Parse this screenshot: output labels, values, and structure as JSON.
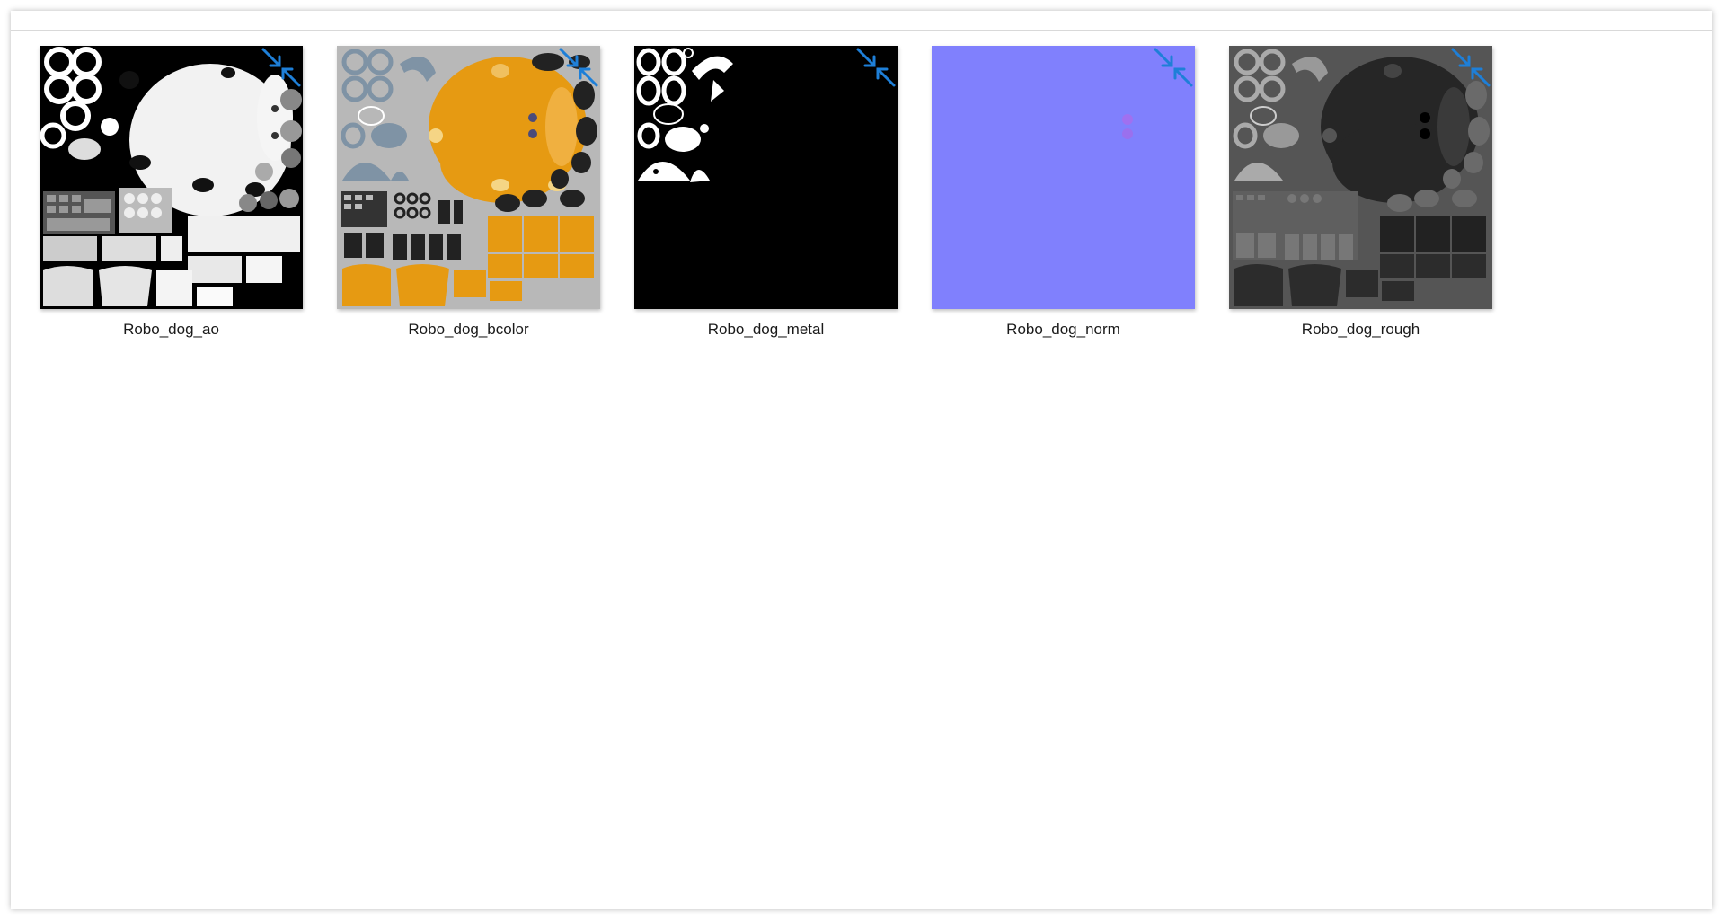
{
  "window": {
    "view": "large-icons"
  },
  "files": [
    {
      "name": "Robo_dog_ao",
      "preview": "ao",
      "overlay_icon": "compress-arrows-icon"
    },
    {
      "name": "Robo_dog_bcolor",
      "preview": "bcolor",
      "overlay_icon": "compress-arrows-icon"
    },
    {
      "name": "Robo_dog_metal",
      "preview": "metal",
      "overlay_icon": "compress-arrows-icon"
    },
    {
      "name": "Robo_dog_norm",
      "preview": "norm",
      "overlay_icon": "compress-arrows-icon"
    },
    {
      "name": "Robo_dog_rough",
      "preview": "rough",
      "overlay_icon": "compress-arrows-icon"
    }
  ],
  "colors": {
    "overlay_blue": "#1e7fd8",
    "bcolor_orange": "#e69a12",
    "bcolor_gray": "#b8b8b8",
    "bcolor_slate": "#7f93a5",
    "norm_purple": "#8080fd",
    "rough_gray": "#555555",
    "metal_black": "#000000"
  }
}
